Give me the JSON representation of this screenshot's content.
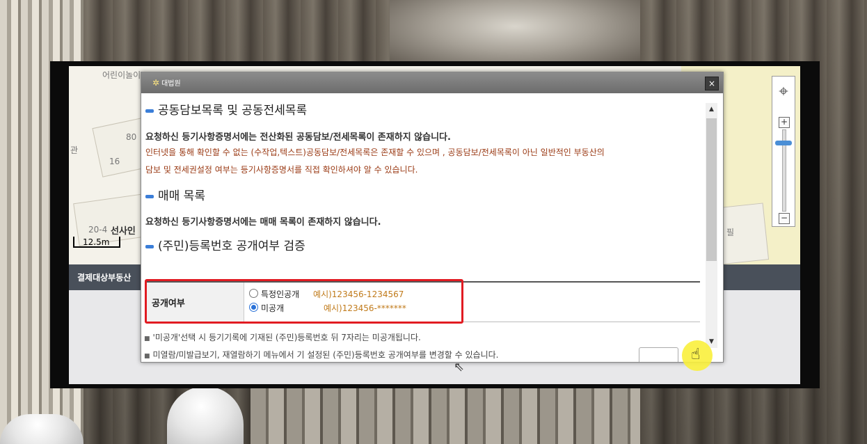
{
  "map": {
    "labels": [
      "어린이놀이",
      "80",
      "16",
      "관",
      "20-4",
      "선사인",
      "필"
    ],
    "scale": "12.5m"
  },
  "band": {
    "label": "결제대상부동산"
  },
  "dialog": {
    "logo": "대법원",
    "close": "×",
    "sections": [
      {
        "title": "공동담보목록 및 공동전세목록",
        "bold": "요청하신 등기사항증명서에는 전산화된 공동담보/전세목록이 존재하지 않습니다.",
        "red1": "인터넷을 통해 확인할 수 없는 (수작업,텍스트)공동담보/전세목록은 존재할 수 있으며 , 공동담보/전세목록이 아닌 일반적인 부동산의",
        "red2": "담보 및 전세권설정 여부는 등기사항증명서를 직접 확인하셔야 알 수 있습니다."
      },
      {
        "title": "매매 목록",
        "bold": "요청하신 등기사항증명서에는 매매 목록이 존재하지 않습니다."
      },
      {
        "title": "(주민)등록번호 공개여부 검증"
      }
    ],
    "table": {
      "label": "공개여부",
      "options": [
        {
          "label": "특정인공개",
          "example": "예시)123456-1234567",
          "selected": false
        },
        {
          "label": "미공개",
          "example": "예시)123456-*******",
          "selected": true
        }
      ]
    },
    "notes": [
      "'미공개'선택 시 등기기록에 기재된 (주민)등록번호 뒤 7자리는 미공개됩니다.",
      "미열람/미발급보기, 재열람하기 메뉴에서 기 설정된 (주민)등록번호 공개여부를 변경할 수 있습니다."
    ]
  },
  "colors": {
    "highlight": "#e11b22",
    "accent": "#2a72d8",
    "warning_text": "#9a3a14"
  },
  "icons": [
    "close-icon",
    "scroll-up-icon",
    "scroll-down-icon",
    "zoom-in-icon",
    "zoom-out-icon",
    "hand-cursor-icon",
    "move-cursor-icon",
    "korea-map-icon"
  ]
}
